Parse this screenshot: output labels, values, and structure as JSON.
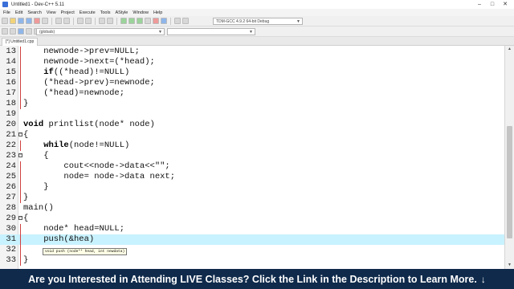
{
  "window": {
    "title": "Untitled1 - Dev-C++ 5.11"
  },
  "menu": [
    "File",
    "Edit",
    "Search",
    "View",
    "Project",
    "Execute",
    "Tools",
    "AStyle",
    "Window",
    "Help"
  ],
  "toolbar": {
    "compiler_select": "TDM-GCC 4.9.2 64-bit Debug",
    "globals_select": "(globals)"
  },
  "tabs": [
    {
      "label": "[*] Untitled1.cpp"
    }
  ],
  "editor": {
    "lines": [
      {
        "num": "13",
        "text": "    newnode->prev=NULL;"
      },
      {
        "num": "14",
        "text": "    newnode->next=(*head);"
      },
      {
        "num": "15",
        "text": "    if((*head)!=NULL)"
      },
      {
        "num": "16",
        "text": "    (*head->prev)=newnode;"
      },
      {
        "num": "17",
        "text": "    (*head)=newnode;"
      },
      {
        "num": "18",
        "text": "}"
      },
      {
        "num": "19",
        "text": ""
      },
      {
        "num": "20",
        "text": "void printlist(node* node)"
      },
      {
        "num": "21",
        "text": "{"
      },
      {
        "num": "22",
        "text": "    while(node!=NULL)"
      },
      {
        "num": "23",
        "text": "    {"
      },
      {
        "num": "24",
        "text": "        cout<<node->data<<\"\";"
      },
      {
        "num": "25",
        "text": "        node= node->data next;"
      },
      {
        "num": "26",
        "text": "    }"
      },
      {
        "num": "27",
        "text": "}"
      },
      {
        "num": "28",
        "text": "main()"
      },
      {
        "num": "29",
        "text": "{"
      },
      {
        "num": "30",
        "text": "    node* head=NULL;"
      },
      {
        "num": "31",
        "text": "    push(&hea)"
      },
      {
        "num": "32",
        "text": ""
      },
      {
        "num": "33",
        "text": "}"
      }
    ],
    "highlighted_line": "31",
    "tooltip": "void push (node** head, int newdata)"
  },
  "banner": {
    "text": "Are you Interested in Attending LIVE Classes? Click the Link in the Description to Learn More.",
    "arrow": "↓"
  },
  "colors": {
    "highlight": "#c8f2ff",
    "banner_bg": "#0f2a4b",
    "fold_marker": "#d04040"
  }
}
